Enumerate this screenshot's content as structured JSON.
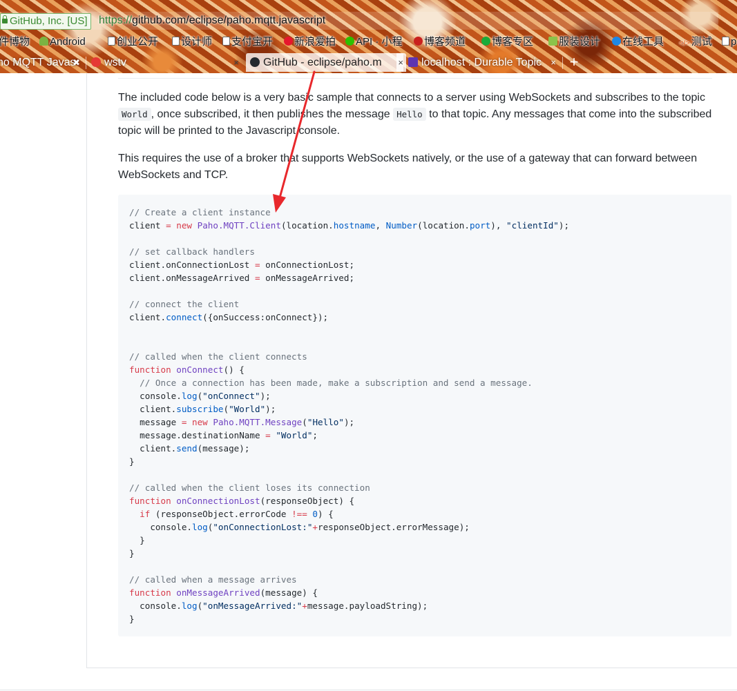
{
  "browser": {
    "ev_badge": "GitHub, Inc. [US]",
    "url_scheme": "https://",
    "url_rest": "github.com/eclipse/paho.mqtt.javascript",
    "bookmarks": [
      {
        "label": "件博物",
        "icon": "none"
      },
      {
        "label": "Android",
        "icon": "android-icon"
      },
      {
        "label": "创业公开",
        "icon": "page-icon"
      },
      {
        "label": "设计师",
        "icon": "page-icon"
      },
      {
        "label": "支付宝开",
        "icon": "page-icon"
      },
      {
        "label": "新浪爱拍",
        "icon": "weibo-icon"
      },
      {
        "label": "API · 小程",
        "icon": "wechat-icon"
      },
      {
        "label": "博客频道",
        "icon": "csdn-icon"
      },
      {
        "label": "博客专区",
        "icon": "c-icon"
      },
      {
        "label": "服装设计",
        "icon": "sheet-icon"
      },
      {
        "label": "在线工具",
        "icon": "tool-icon"
      },
      {
        "label": "测试",
        "icon": "code-icon"
      },
      {
        "label": "p",
        "icon": "page-icon"
      }
    ],
    "tabs": [
      {
        "label": "no MQTT Javas",
        "active": false,
        "close": "✖"
      },
      {
        "label": "wstv",
        "active": false,
        "close": "×"
      },
      {
        "label": "GitHub - eclipse/paho.m",
        "active": true,
        "close": "×"
      },
      {
        "label": "localhost : Durable Topic",
        "active": false,
        "close": "×"
      }
    ],
    "new_tab": "+"
  },
  "content": {
    "para1_a": "The included code below is a very basic sample that connects to a server using WebSockets and subscribes to the topic",
    "para1_code1": "World",
    "para1_b": ", once subscribed, it then publishes the message",
    "para1_code2": "Hello",
    "para1_c": "to that topic. Any messages that come into the subscribed",
    "para1_d": "topic will be printed to the Javascript console.",
    "para2_a": "This requires the use of a broker that supports WebSockets natively, or the use of a gateway that can forward between",
    "para2_b": "WebSockets and TCP.",
    "code": {
      "l1": "// Create a client instance",
      "l2_a": "client ",
      "l2_eq": "=",
      "l2_new": "new",
      "l2_cls": "Paho.MQTT.Client",
      "l2_b": "(location.",
      "l2_host": "hostname",
      "l2_c": ", ",
      "l2_num": "Number",
      "l2_d": "(location.",
      "l2_port": "port",
      "l2_e": "), ",
      "l2_str": "\"clientId\"",
      "l2_f": ");",
      "l4": "// set callback handlers",
      "l5_a": "client.onConnectionLost ",
      "l5_eq": "=",
      "l5_b": " onConnectionLost;",
      "l6_a": "client.onMessageArrived ",
      "l6_eq": "=",
      "l6_b": " onMessageArrived;",
      "l8": "// connect the client",
      "l9_a": "client.",
      "l9_fn": "connect",
      "l9_b": "({onSuccess:onConnect});",
      "l12": "// called when the client connects",
      "l13_kw": "function",
      "l13_fn": "onConnect",
      "l13_b": "() {",
      "l14": "  // Once a connection has been made, make a subscription and send a message.",
      "l15_a": "  console.",
      "l15_fn": "log",
      "l15_b": "(",
      "l15_str": "\"onConnect\"",
      "l15_c": ");",
      "l16_a": "  client.",
      "l16_fn": "subscribe",
      "l16_b": "(",
      "l16_str": "\"World\"",
      "l16_c": ");",
      "l17_a": "  message ",
      "l17_eq": "=",
      "l17_new": "new",
      "l17_cls": "Paho.MQTT.Message",
      "l17_b": "(",
      "l17_str": "\"Hello\"",
      "l17_c": ");",
      "l18_a": "  message.destinationName ",
      "l18_eq": "=",
      "l18_str": "\"World\"",
      "l18_b": ";",
      "l19_a": "  client.",
      "l19_fn": "send",
      "l19_b": "(message);",
      "l20": "}",
      "l22": "// called when the client loses its connection",
      "l23_kw": "function",
      "l23_fn": "onConnectionLost",
      "l23_b": "(responseObject) {",
      "l24_kw": "  if",
      "l24_a": " (responseObject.errorCode ",
      "l24_op": "!==",
      "l24_num": "0",
      "l24_b": ") {",
      "l25_a": "    console.",
      "l25_fn": "log",
      "l25_b": "(",
      "l25_str": "\"onConnectionLost:\"",
      "l25_op": "+",
      "l25_c": "responseObject.errorMessage);",
      "l26": "  }",
      "l27": "}",
      "l29": "// called when a message arrives",
      "l30_kw": "function",
      "l30_fn": "onMessageArrived",
      "l30_b": "(message) {",
      "l31_a": "  console.",
      "l31_fn": "log",
      "l31_b": "(",
      "l31_str": "\"onMessageArrived:\"",
      "l31_op": "+",
      "l31_c": "message.payloadString);",
      "l32": "}"
    }
  },
  "colors": {
    "annotation_arrow": "#e8282c",
    "comment": "#6a737d",
    "keyword": "#d73a49",
    "entity": "#6f42c1",
    "constant": "#005cc5",
    "string": "#032f62"
  }
}
